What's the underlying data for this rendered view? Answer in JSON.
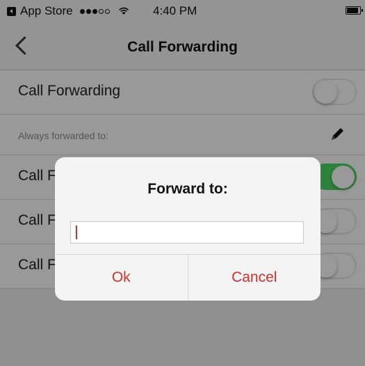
{
  "status_bar": {
    "back_app": "App Store",
    "time": "4:40 PM",
    "signal_icon": "signal-dots-icon",
    "wifi_icon": "wifi-icon",
    "battery_icon": "battery-icon"
  },
  "nav": {
    "title": "Call Forwarding",
    "back_icon": "chevron-left-icon"
  },
  "rows": [
    {
      "label": "Call Forwarding",
      "toggle_on": false
    },
    {
      "label": "Always forwarded to:",
      "icon": "pencil-icon"
    },
    {
      "label": "Call F",
      "toggle_on": true
    },
    {
      "label": "Call F",
      "toggle_on": false
    },
    {
      "label": "Call Forwarding No Answer",
      "toggle_on": false
    }
  ],
  "dialog": {
    "title": "Forward to:",
    "input_value": "",
    "ok_label": "Ok",
    "cancel_label": "Cancel"
  },
  "colors": {
    "accent": "#d0312d",
    "toggle_on": "#4cd964",
    "overlay": "rgba(0,0,0,0.40)"
  }
}
